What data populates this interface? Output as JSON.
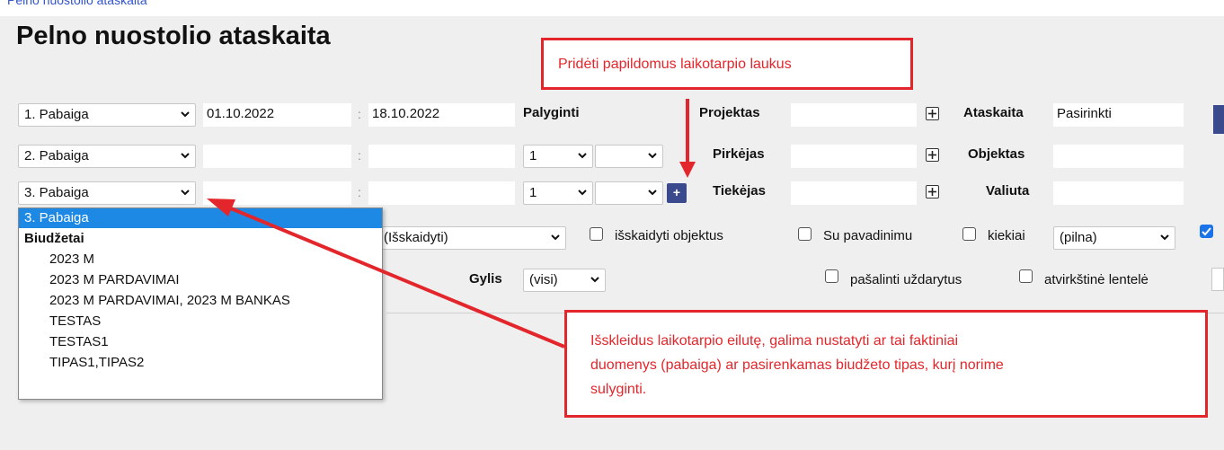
{
  "header": {
    "partial_top_text": "Pelno nuostolio ataskaita"
  },
  "title": "Pelno nuostolio ataskaita",
  "periods": [
    {
      "select": "1. Pabaiga",
      "from": "01.10.2022",
      "to": "18.10.2022"
    },
    {
      "select": "2. Pabaiga",
      "from": "",
      "to": ""
    },
    {
      "select": "3. Pabaiga",
      "from": "",
      "to": ""
    }
  ],
  "colon": ":",
  "compare": {
    "label": "Palyginti",
    "rows": [
      {
        "num": "1",
        "second": ""
      },
      {
        "num": "1",
        "second": ""
      }
    ],
    "add_button": "+"
  },
  "filters": [
    {
      "label": "Projektas",
      "value": ""
    },
    {
      "label": "Pirkėjas",
      "value": ""
    },
    {
      "label": "Tiekėjas",
      "value": ""
    }
  ],
  "right_filters": [
    {
      "label": "Ataskaita",
      "value": "Pasirinkti"
    },
    {
      "label": "Objektas",
      "value": ""
    },
    {
      "label": "Valiuta",
      "value": ""
    }
  ],
  "options_row": {
    "breakdown_select": "(Išskaidyti)",
    "cb_split_objects": "išskaidyti objektus",
    "cb_with_name": "Su pavadinimu",
    "cb_quantities": "kiekiai",
    "quantities_select": "(pilna)",
    "cb_right_checked": true
  },
  "depth_row": {
    "label": "Gylis",
    "select": "(visi)",
    "cb_remove_closed": "pašalinti uždarytus",
    "cb_reverse_table": "atvirkštinė lentelė"
  },
  "dropdown": {
    "items": [
      {
        "label": "3. Pabaiga",
        "kind": "selected"
      },
      {
        "label": "Biudžetai",
        "kind": "group"
      },
      {
        "label": "2023 M",
        "kind": "child"
      },
      {
        "label": "2023 M PARDAVIMAI",
        "kind": "child"
      },
      {
        "label": "2023 M PARDAVIMAI, 2023 M BANKAS",
        "kind": "child"
      },
      {
        "label": "TESTAS",
        "kind": "child"
      },
      {
        "label": "TESTAS1",
        "kind": "child"
      },
      {
        "label": "TIPAS1,TIPAS2",
        "kind": "child"
      }
    ]
  },
  "callouts": {
    "top": "Pridėti papildomus laikotarpio laukus",
    "bottom_line1": "Išskleidus laikotarpio eilutę, galima nustatyti ar tai faktiniai",
    "bottom_line2": "duomenys (pabaiga) ar pasirenkamas biudžeto tipas, kurį norime",
    "bottom_line3": "sulyginti."
  },
  "colors": {
    "accent": "#e3262b",
    "selected": "#1e88e5",
    "button": "#3b4a8c",
    "panel": "#efefef"
  }
}
